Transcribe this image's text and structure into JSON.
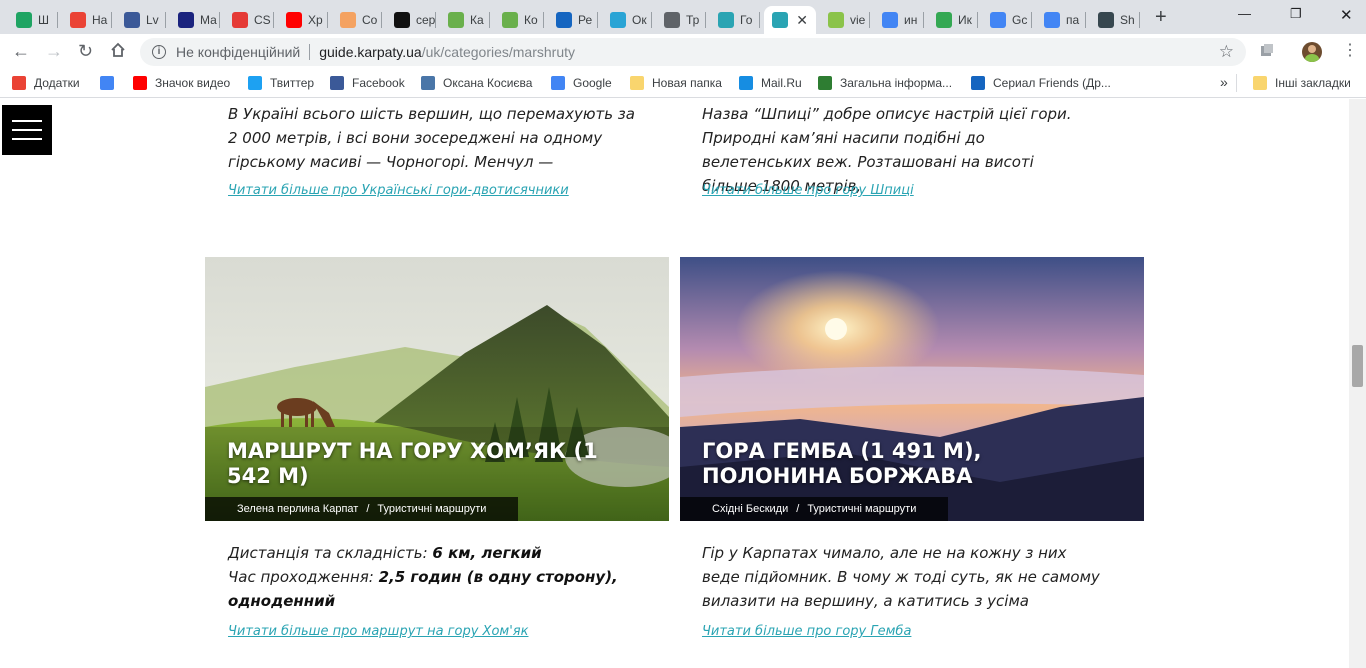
{
  "tabs": [
    {
      "label": "Ш",
      "color": "#1fa463"
    },
    {
      "label": "На",
      "color": "#ea4335"
    },
    {
      "label": "Lv",
      "color": "#3b5998"
    },
    {
      "label": "Ма",
      "color": "#1a237e"
    },
    {
      "label": "CS",
      "color": "#e53935"
    },
    {
      "label": "Хр",
      "color": "#ff0000"
    },
    {
      "label": "Со",
      "color": "#f4a261"
    },
    {
      "label": "сер",
      "color": "#111111"
    },
    {
      "label": "Ка",
      "color": "#6ab04c"
    },
    {
      "label": "Ко",
      "color": "#6ab04c"
    },
    {
      "label": "Ре",
      "color": "#1565c0"
    },
    {
      "label": "Ок",
      "color": "#2aa4d5"
    },
    {
      "label": "Тр",
      "color": "#5f6368"
    },
    {
      "label": "Го",
      "color": "#2aa4b3"
    },
    {
      "label": "",
      "color": "#2aa4b3",
      "active": true
    },
    {
      "label": "vie",
      "color": "#8bc34a"
    },
    {
      "label": "ин",
      "color": "#4285f4"
    },
    {
      "label": "Ик",
      "color": "#34a853"
    },
    {
      "label": "Gc",
      "color": "#4285f4"
    },
    {
      "label": "па",
      "color": "#4285f4"
    },
    {
      "label": "Sh",
      "color": "#37474f"
    }
  ],
  "toolbar": {
    "security_label": "Не конфіденційний",
    "url_host": "guide.karpaty.ua",
    "url_path": "/uk/categories/marshruty"
  },
  "bookmarks": [
    {
      "label": "Додатки",
      "color": "#ea4335"
    },
    {
      "label": "",
      "color": "#4285f4"
    },
    {
      "label": "Значок видео",
      "color": "#ff0000"
    },
    {
      "label": "Твиттер",
      "color": "#1da1f2"
    },
    {
      "label": "Facebook",
      "color": "#3b5998"
    },
    {
      "label": "Оксана Косиєва",
      "color": "#4a76a8"
    },
    {
      "label": "Google",
      "color": "#4285f4"
    },
    {
      "label": "Новая папка",
      "color": "#f9d56e"
    },
    {
      "label": "Mail.Ru",
      "color": "#168de2"
    },
    {
      "label": "Загальна інформа...",
      "color": "#2e7d32"
    },
    {
      "label": "Сериал Friends (Др...",
      "color": "#1565c0"
    },
    {
      "label": "Інші закладки",
      "color": "#f9d56e"
    }
  ],
  "top_left": {
    "excerpt": "В Україні всього шість вершин, що перемахують за 2 000 метрів, і всі вони зосереджені на одному гірському масиві — Чорногорі. Менчул —",
    "link": "Читати більше про Українські гори-двотисячники"
  },
  "top_right": {
    "excerpt": "Назва “Шпиці” добре описує настрій цієї гори. Природні кам’яні насипи подібні до велетенських веж. Розташовані на висоті більше 1800 метрів,",
    "link": "Читати більше про гору Шпиці"
  },
  "card_left": {
    "title": "МАРШРУТ НА ГОРУ ХОМ’ЯК (1 542 М)",
    "cat1": "Зелена перлина Карпат",
    "cat2": "Туристичні маршрути",
    "l1_label": "Дистанція та складність: ",
    "l1_value": "6 км, легкий",
    "l2_label": "Час проходження: ",
    "l2_value": "2,5 годин (в одну сторону), одноденний",
    "link": "Читати більше про маршрут на гору Хом'як"
  },
  "card_right": {
    "title": "ГОРА ГЕМБА (1 491 М), ПОЛОНИНА БОРЖАВА",
    "cat1": "Східні Бескиди",
    "cat2": "Туристичні маршрути",
    "excerpt": "Гір у Карпатах чимало, але не на кожну з них веде підйомник. В чому ж тоді суть, як не самому вилазити на вершину, а катитись з усіма",
    "link": "Читати більше про гору Гемба"
  },
  "category_separator": "/",
  "colors": {
    "link": "#2aa4b3",
    "tabstrip": "#dee1e6"
  }
}
